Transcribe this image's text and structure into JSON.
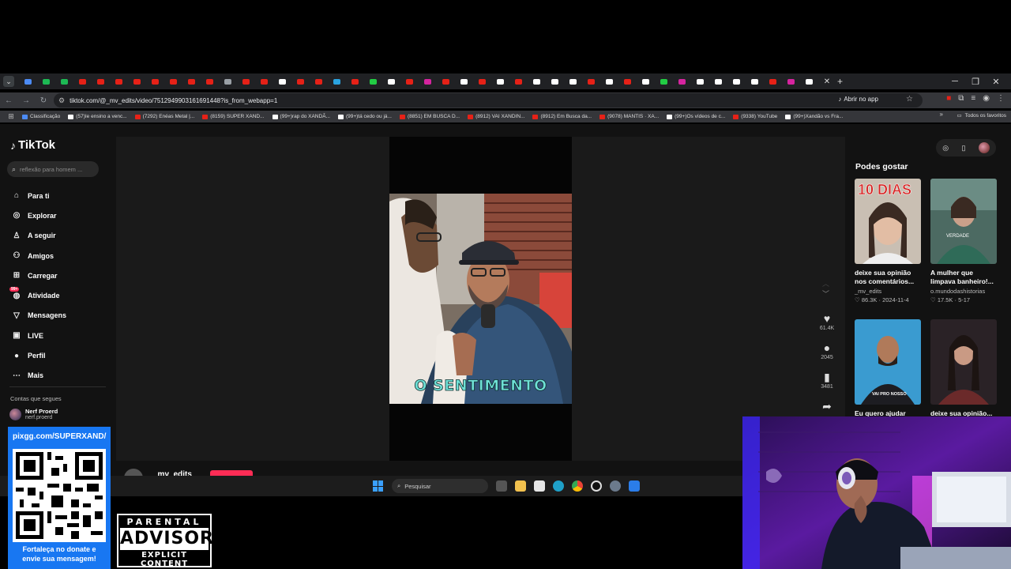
{
  "browser": {
    "tab_favicon_colors": [
      "#4c8bf5",
      "#1db954",
      "#1db954",
      "#e62117",
      "#e62117",
      "#e62117",
      "#e62117",
      "#e62117",
      "#e62117",
      "#e62117",
      "#e62117",
      "#9aa0a6",
      "#e62117",
      "#e62117",
      "#ffffff",
      "#e62117",
      "#e62117",
      "#2aa3e0",
      "#e62117",
      "#22cc44",
      "#ffffff",
      "#e62117",
      "#d6249f",
      "#e62117",
      "#ffffff",
      "#e62117",
      "#ffffff",
      "#e62117",
      "#ffffff",
      "#ffffff",
      "#ffffff",
      "#e62117",
      "#ffffff",
      "#e62117",
      "#ffffff",
      "#22cc44",
      "#d6249f",
      "#ffffff",
      "#ffffff",
      "#ffffff",
      "#ffffff",
      "#e62117",
      "#d6249f",
      "#ffffff"
    ],
    "url": "tiktok.com/@_mv_edits/video/7512949903161691448?is_from_webapp=1",
    "open_app_label": "Abrir no app",
    "bookmarks": [
      {
        "label": "Classificação",
        "color": "#4c8bf5"
      },
      {
        "label": "(57)Ie ensino a venc...",
        "color": "#ffffff"
      },
      {
        "label": "(7292) Enéas Metal |...",
        "color": "#e62117"
      },
      {
        "label": "(8159) SUPER XAND...",
        "color": "#e62117"
      },
      {
        "label": "(99+)rap do XANDÃ...",
        "color": "#ffffff"
      },
      {
        "label": "(99+)tá cedo ou já...",
        "color": "#ffffff"
      },
      {
        "label": "(8851) EM BUSCA D...",
        "color": "#e62117"
      },
      {
        "label": "(8912) VAI XANDIN...",
        "color": "#e62117"
      },
      {
        "label": "(8912) Em Busca da...",
        "color": "#e62117"
      },
      {
        "label": "(9078) MANTIS · XA...",
        "color": "#e62117"
      },
      {
        "label": "(99+)Os vídeos de c...",
        "color": "#ffffff"
      },
      {
        "label": "(9338) YouTube",
        "color": "#e62117"
      },
      {
        "label": "(99+)Xandão vs Fra...",
        "color": "#ffffff"
      }
    ],
    "all_favorites_label": "Todos os favoritos"
  },
  "tiktok": {
    "logo_text": "TikTok",
    "search_placeholder": "reflexão para homem ...",
    "nav": [
      {
        "icon": "home-icon",
        "label": "Para ti"
      },
      {
        "icon": "explore-icon",
        "label": "Explorar"
      },
      {
        "icon": "following-icon",
        "label": "A seguir"
      },
      {
        "icon": "friends-icon",
        "label": "Amigos"
      },
      {
        "icon": "upload-icon",
        "label": "Carregar"
      },
      {
        "icon": "activity-icon",
        "label": "Atividade",
        "badge": "99+"
      },
      {
        "icon": "messages-icon",
        "label": "Mensagens"
      },
      {
        "icon": "live-icon",
        "label": "LIVE"
      },
      {
        "icon": "profile-icon",
        "label": "Perfil"
      },
      {
        "icon": "more-icon",
        "label": "Mais"
      }
    ],
    "following_title": "Contas que segues",
    "following_account": {
      "name": "Nerf Proerd",
      "handle": "nerf.proerd"
    },
    "video_caption": "O SENTIMENTO",
    "author": "_mv_edits",
    "likes": "61.4K",
    "comments": "2045",
    "saves": "3481",
    "recommend_title": "Podes gostar",
    "recommendations": [
      {
        "text": "deixe sua opinião nos comentários...",
        "user": "_mv_edits",
        "likes": "86.3K",
        "date": "2024-11-4",
        "thumb_text": "10 DIAS"
      },
      {
        "text": "A mulher que limpava banheiro!...",
        "user": "o.mundodashistorias",
        "likes": "17.5K",
        "date": "5-17",
        "thumb_text": "VERDADE"
      },
      {
        "text": "Eu quero ajudar você...",
        "user": "",
        "likes": "",
        "date": "",
        "thumb_text": "VAI PRO NOSSO"
      },
      {
        "text": "deixe sua opinião...",
        "user": "",
        "likes": "",
        "date": "",
        "thumb_text": ""
      }
    ]
  },
  "taskbar": {
    "search_label": "Pesquisar"
  },
  "overlay": {
    "pix_url": "pixgg.com/SUPERXAND/",
    "pix_message_1": "Fortaleça no donate e",
    "pix_message_2": "envie sua mensagem!",
    "advisory_top": "PARENTAL",
    "advisory_mid": "ADVISORY",
    "advisory_bot": "EXPLICIT CONTENT"
  }
}
